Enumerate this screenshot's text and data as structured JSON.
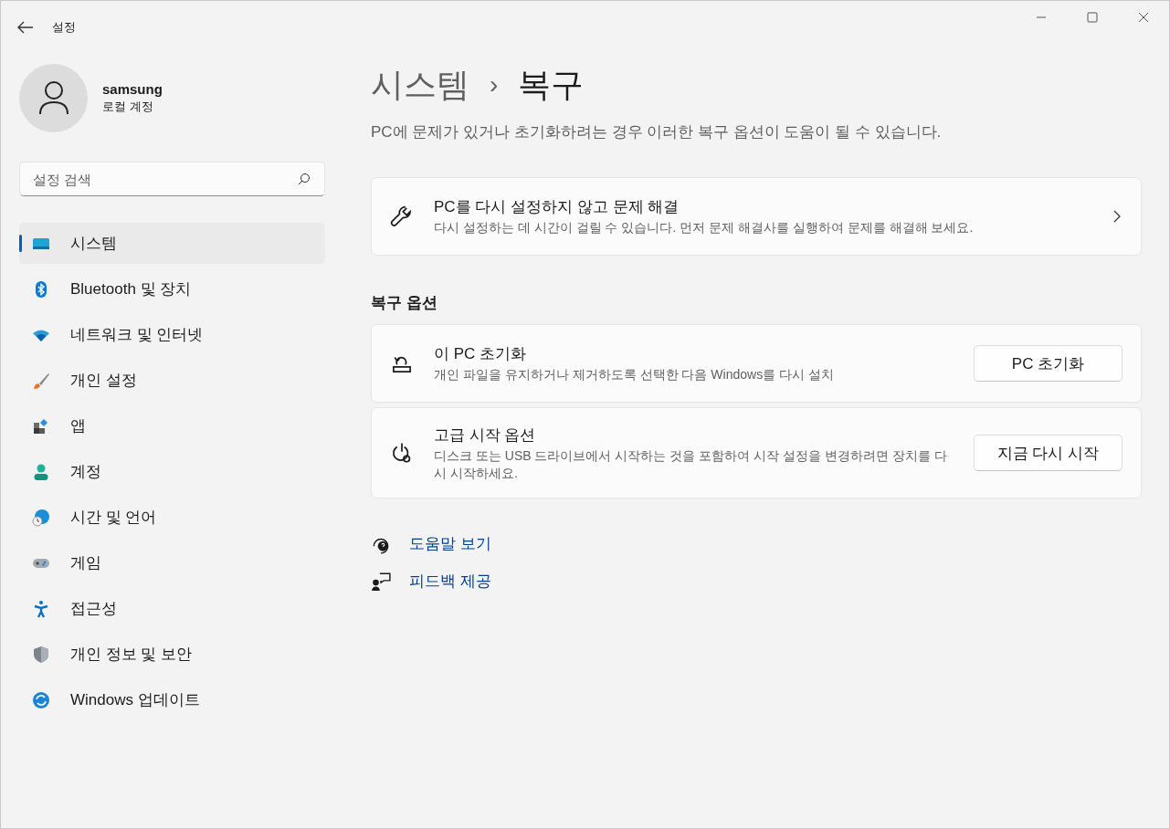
{
  "window": {
    "title": "설정"
  },
  "user": {
    "name": "samsung",
    "account": "로컬 계정"
  },
  "search": {
    "placeholder": "설정 검색"
  },
  "nav": [
    {
      "label": "시스템",
      "kind": "system",
      "selected": true
    },
    {
      "label": "Bluetooth 및 장치",
      "kind": "bluetooth",
      "selected": false
    },
    {
      "label": "네트워크 및 인터넷",
      "kind": "wifi",
      "selected": false
    },
    {
      "label": "개인 설정",
      "kind": "brush",
      "selected": false
    },
    {
      "label": "앱",
      "kind": "apps",
      "selected": false
    },
    {
      "label": "계정",
      "kind": "person",
      "selected": false
    },
    {
      "label": "시간 및 언어",
      "kind": "globe",
      "selected": false
    },
    {
      "label": "게임",
      "kind": "game",
      "selected": false
    },
    {
      "label": "접근성",
      "kind": "access",
      "selected": false
    },
    {
      "label": "개인 정보 및 보안",
      "kind": "shield",
      "selected": false
    },
    {
      "label": "Windows 업데이트",
      "kind": "update",
      "selected": false
    }
  ],
  "breadcrumb": {
    "parent": "시스템",
    "separator": "›",
    "current": "복구"
  },
  "description": "PC에 문제가 있거나 초기화하려는 경우 이러한 복구 옵션이 도움이 될 수 있습니다.",
  "top_card": {
    "kind": "link",
    "title": "PC를 다시 설정하지 않고 문제 해결",
    "subtitle": "다시 설정하는 데 시간이 걸릴 수 있습니다. 먼저 문제 해결사를 실행하여 문제를 해결해 보세요."
  },
  "section_title": "복구 옵션",
  "options": [
    {
      "kind": "button",
      "title": "이 PC 초기화",
      "subtitle": "개인 파일을 유지하거나 제거하도록 선택한 다음 Windows를 다시 설치",
      "button": "PC 초기화"
    },
    {
      "kind": "button",
      "title": "고급 시작 옵션",
      "subtitle": "디스크 또는 USB 드라이브에서 시작하는 것을 포함하여 시작 설정을 변경하려면 장치를 다시 시작하세요.",
      "button": "지금 다시 시작"
    }
  ],
  "links": [
    {
      "label": "도움말 보기"
    },
    {
      "label": "피드백 제공"
    }
  ]
}
